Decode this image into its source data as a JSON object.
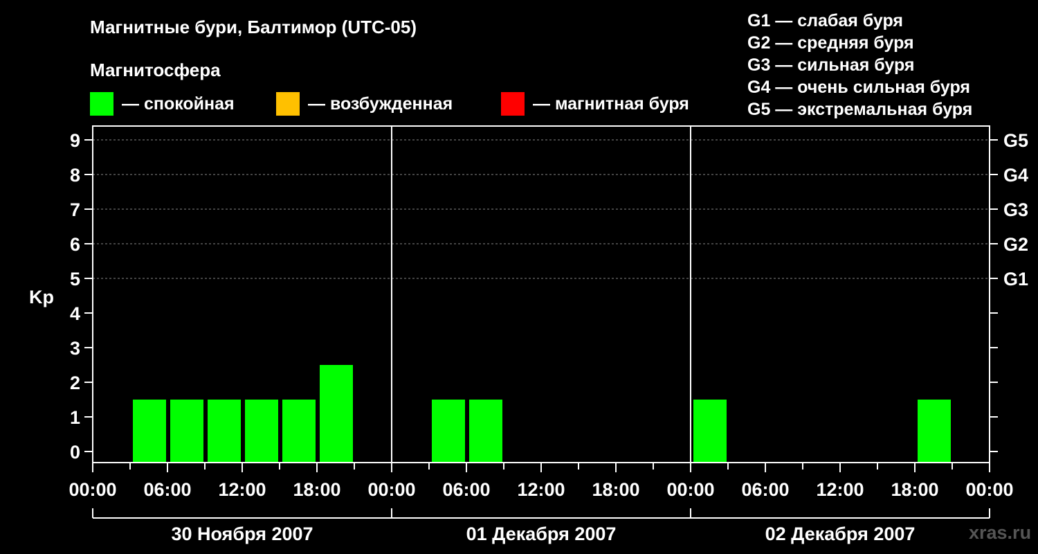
{
  "header": {
    "title": "Магнитные бури, Балтимор (UTC-05)",
    "subtitle": "Магнитосфера"
  },
  "legend": [
    {
      "label": "— спокойная",
      "color": "#00ff00"
    },
    {
      "label": "— возбужденная",
      "color": "#ffc000"
    },
    {
      "label": "— магнитная буря",
      "color": "#ff0000"
    }
  ],
  "g_scale": [
    "G1 — слабая буря",
    "G2 — средняя буря",
    "G3 — сильная буря",
    "G4 — очень сильная буря",
    "G5 — экстремальная буря"
  ],
  "watermark": "xras.ru",
  "chart_data": {
    "type": "bar",
    "ylabel": "Kp",
    "ylim": [
      0,
      9
    ],
    "y_ticks": [
      "0",
      "1",
      "2",
      "3",
      "4",
      "5",
      "6",
      "7",
      "8",
      "9"
    ],
    "right_ticks": [
      {
        "kp": 5,
        "label": "G1"
      },
      {
        "kp": 6,
        "label": "G2"
      },
      {
        "kp": 7,
        "label": "G3"
      },
      {
        "kp": 8,
        "label": "G4"
      },
      {
        "kp": 9,
        "label": "G5"
      }
    ],
    "x_tick_labels": [
      "00:00",
      "06:00",
      "12:00",
      "18:00",
      "00:00",
      "06:00",
      "12:00",
      "18:00",
      "00:00",
      "06:00",
      "12:00",
      "18:00",
      "00:00"
    ],
    "days": [
      "30 Ноября 2007",
      "01 Декабря 2007",
      "02 Декабря 2007"
    ],
    "interval_hours": 3,
    "grid": "dashed at Kp 5–9",
    "values": [
      0,
      1,
      1,
      1,
      1,
      1,
      2,
      0,
      0,
      1,
      1,
      0,
      0,
      0,
      0,
      0,
      1,
      0,
      0,
      0,
      0,
      0,
      1,
      0
    ],
    "colors": {
      "quiet": "#00ff00",
      "active": "#ffc000",
      "storm": "#ff0000"
    }
  }
}
